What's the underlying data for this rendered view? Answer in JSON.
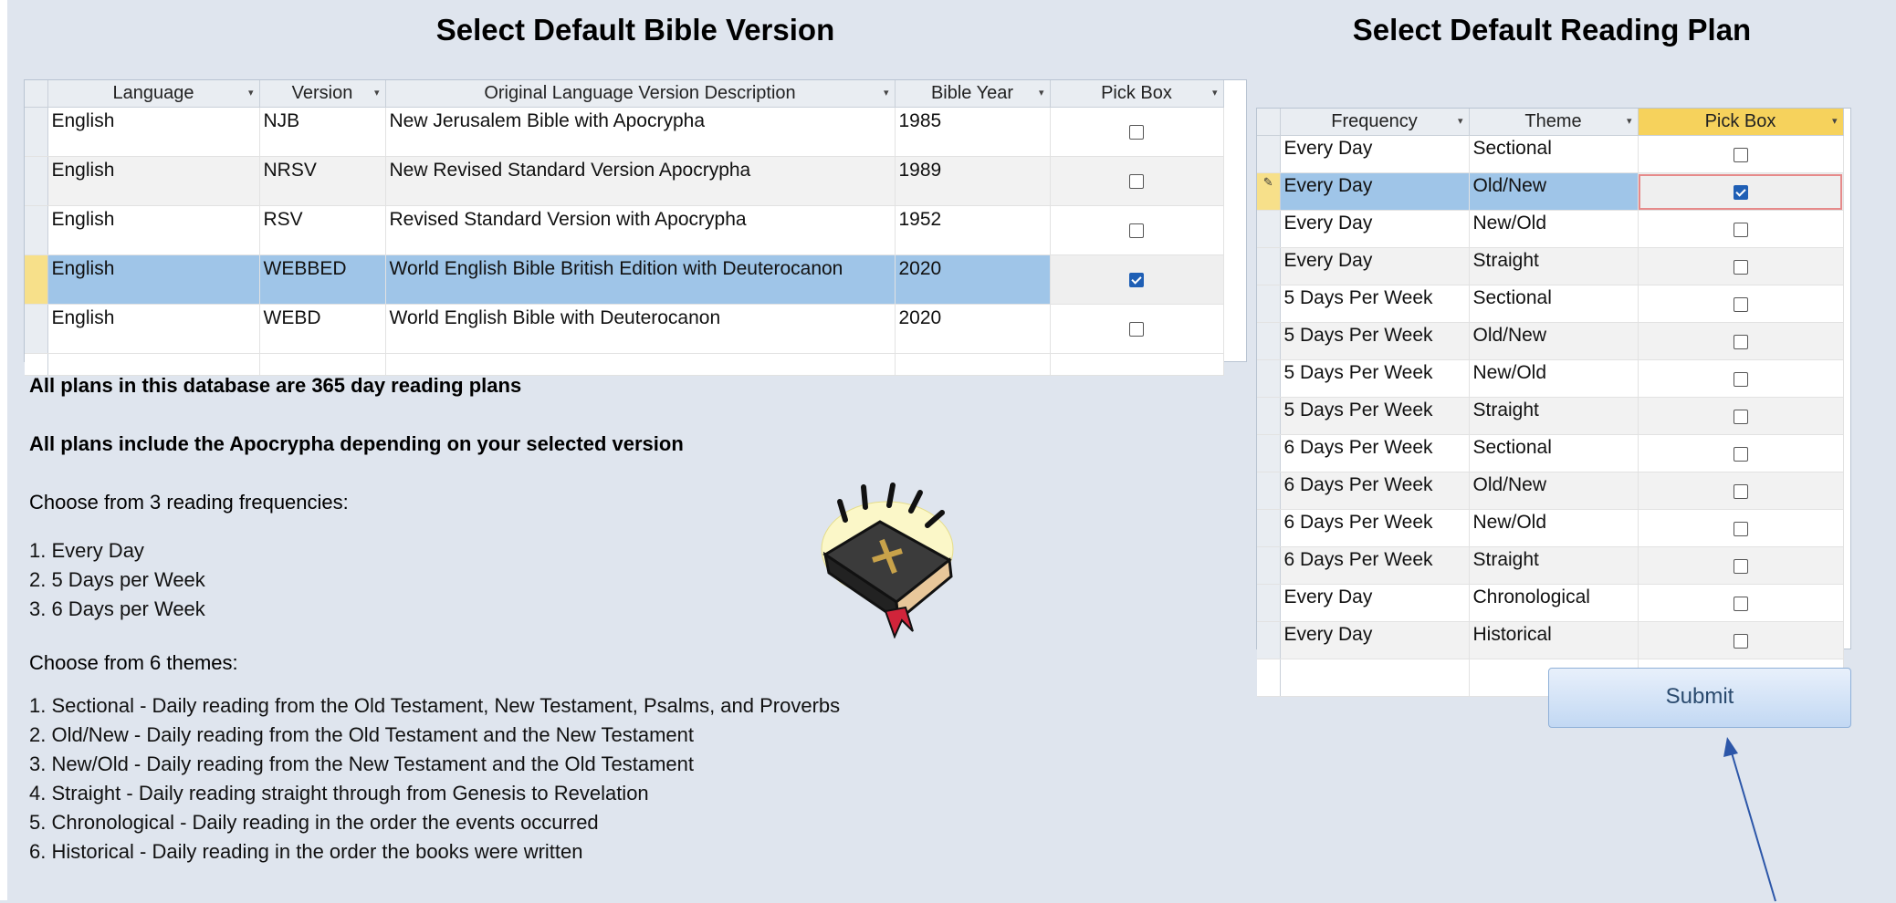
{
  "left_title": "Select Default Bible Version",
  "right_title": "Select Default Reading Plan",
  "versions": {
    "columns": [
      "Language",
      "Version",
      "Original Language Version Description",
      "Bible Year",
      "Pick Box"
    ],
    "rows": [
      {
        "language": "English",
        "version": "NJB",
        "description": "New Jerusalem Bible with Apocrypha",
        "year": "1985",
        "picked": false
      },
      {
        "language": "English",
        "version": "NRSV",
        "description": "New Revised Standard Version Apocrypha",
        "year": "1989",
        "picked": false
      },
      {
        "language": "English",
        "version": "RSV",
        "description": "Revised Standard Version with Apocrypha",
        "year": "1952",
        "picked": false
      },
      {
        "language": "English",
        "version": "WEBBED",
        "description": "World English Bible British Edition with Deuterocanon",
        "year": "2020",
        "picked": true
      },
      {
        "language": "English",
        "version": "WEBD",
        "description": "World English Bible with Deuterocanon",
        "year": "2020",
        "picked": false
      }
    ]
  },
  "plans": {
    "columns": [
      "Frequency",
      "Theme",
      "Pick Box"
    ],
    "rows": [
      {
        "frequency": "Every Day",
        "theme": "Sectional",
        "picked": false
      },
      {
        "frequency": "Every Day",
        "theme": "Old/New",
        "picked": true
      },
      {
        "frequency": "Every Day",
        "theme": "New/Old",
        "picked": false
      },
      {
        "frequency": "Every Day",
        "theme": "Straight",
        "picked": false
      },
      {
        "frequency": "5 Days Per Week",
        "theme": "Sectional",
        "picked": false
      },
      {
        "frequency": "5 Days Per Week",
        "theme": "Old/New",
        "picked": false
      },
      {
        "frequency": "5 Days Per Week",
        "theme": "New/Old",
        "picked": false
      },
      {
        "frequency": "5 Days Per Week",
        "theme": "Straight",
        "picked": false
      },
      {
        "frequency": "6 Days Per Week",
        "theme": "Sectional",
        "picked": false
      },
      {
        "frequency": "6 Days Per Week",
        "theme": "Old/New",
        "picked": false
      },
      {
        "frequency": "6 Days Per Week",
        "theme": "New/Old",
        "picked": false
      },
      {
        "frequency": "6 Days Per Week",
        "theme": "Straight",
        "picked": false
      },
      {
        "frequency": "Every Day",
        "theme": "Chronological",
        "picked": false
      },
      {
        "frequency": "Every Day",
        "theme": "Historical",
        "picked": false
      }
    ]
  },
  "info": {
    "plans_365": "All plans in this database are 365 day reading plans",
    "apocrypha": "All plans include the Apocrypha depending on your selected version",
    "freq_heading": "Choose from 3 reading frequencies:",
    "frequencies": [
      "1.  Every Day",
      "2.  5 Days per Week",
      "3.  6 Days per Week"
    ],
    "themes_heading": "Choose from 6 themes:",
    "themes": [
      "1.  Sectional - Daily reading from the Old Testament, New Testament, Psalms, and Proverbs",
      "2.  Old/New - Daily reading from the Old Testament and the New Testament",
      "3.  New/Old - Daily reading from the New Testament and the Old Testament",
      "4.  Straight - Daily reading straight through from Genesis to Revelation",
      "5.  Chronological - Daily reading in the order the events occurred",
      "6.  Historical - Daily reading in the order the books were written"
    ]
  },
  "submit_label": "Submit",
  "icons": {
    "bible": "bible-icon",
    "arrow": "arrow-icon",
    "pencil": "pencil-icon",
    "sort": "chevron-down-icon"
  },
  "colors": {
    "background": "#dfe5ee",
    "selected_row": "#9fc5e8",
    "checkbox": "#1f5fb5",
    "active_header": "#f6d25c"
  }
}
